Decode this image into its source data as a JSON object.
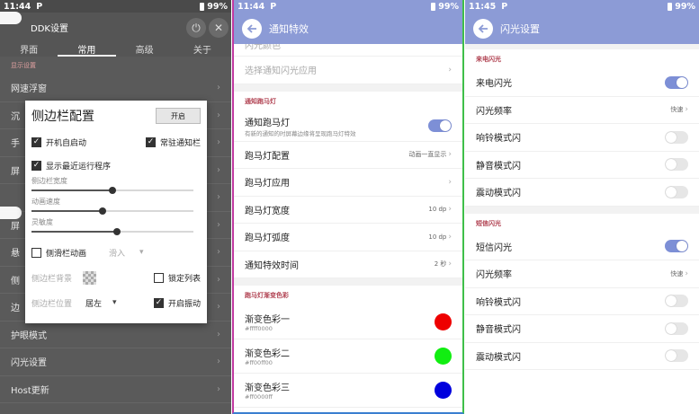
{
  "panel1": {
    "status": {
      "time": "11:44",
      "p": "P",
      "battery": "99%"
    },
    "app_title": "DDK设置",
    "tabs": [
      "界面",
      "常用",
      "高级",
      "关于"
    ],
    "active_tab": 1,
    "section": "显示设置",
    "bg_rows": [
      {
        "label": "网速浮窗"
      },
      {
        "label": "沉"
      },
      {
        "label": "手"
      },
      {
        "label": "屏"
      },
      {
        "label": ""
      },
      {
        "label": "屏"
      },
      {
        "label": "悬"
      },
      {
        "label": "侧"
      },
      {
        "label": "边"
      },
      {
        "label": "护眼模式"
      },
      {
        "label": "闪光设置"
      },
      {
        "label": "Host更新"
      }
    ],
    "dialog": {
      "title": "侧边栏配置",
      "button": "开启",
      "cb_boot": "开机自启动",
      "cb_notify": "常驻通知栏",
      "cb_recent": "显示最近运行程序",
      "slider_width_label": "侧边栏宽度",
      "slider_width_value": 0.5,
      "slider_speed_label": "动画速度",
      "slider_speed_value": 0.44,
      "slider_sens_label": "灵敏度",
      "slider_sens_value": 0.53,
      "cb_anim": "侧滑栏动画",
      "anim_select": "滑入",
      "bg_label": "侧边栏背景",
      "cb_lock": "锁定列表",
      "pos_label": "侧边栏位置",
      "pos_value": "居左",
      "cb_vibrate": "开启振动"
    }
  },
  "panel2": {
    "status": {
      "time": "11:44",
      "p": "P",
      "battery": "99%"
    },
    "title": "通知特效",
    "partial_top": "闪光颜色",
    "select_app": "选择通知闪光应用",
    "section1": "通知跑马灯",
    "marquee_title": "通知跑马灯",
    "marquee_sub": "有新的通知的时屏幕边缘将呈现跑马灯特效",
    "marquee_on": true,
    "config_label": "跑马灯配置",
    "config_value": "动画一直显示",
    "apps_label": "跑马灯应用",
    "width_label": "跑马灯宽度",
    "width_value": "10 dp",
    "arc_label": "跑马灯弧度",
    "arc_value": "10 dp",
    "time_label": "通知特效时间",
    "time_value": "2 秒",
    "section2": "跑马灯渐变色彩",
    "colors": [
      {
        "label": "渐变色彩一",
        "hex": "#ffff0000",
        "color": "#ee0000"
      },
      {
        "label": "渐变色彩二",
        "hex": "#ff00ff00",
        "color": "#11ee11"
      },
      {
        "label": "渐变色彩三",
        "hex": "#ff0000ff",
        "color": "#0000dd"
      }
    ]
  },
  "panel3": {
    "status": {
      "time": "11:45",
      "p": "P",
      "battery": "99%"
    },
    "title": "闪光设置",
    "section1": "来电闪光",
    "call_flash": "来电闪光",
    "call_flash_on": true,
    "freq_label": "闪光频率",
    "freq_value": "快速",
    "ring_label": "响铃模式闪",
    "silent_label": "静音模式闪",
    "vibrate_label": "震动模式闪",
    "section2": "短信闪光",
    "sms_flash": "短信闪光",
    "sms_flash_on": true,
    "freq2_label": "闪光频率",
    "freq2_value": "快速",
    "ring2_label": "响铃模式闪",
    "silent2_label": "静音模式闪",
    "vibrate2_label": "震动模式闪"
  },
  "colors": {
    "appbar": "#8c9bd6",
    "toggle_on": "#7d8fd6",
    "section_text": "#b04050"
  }
}
